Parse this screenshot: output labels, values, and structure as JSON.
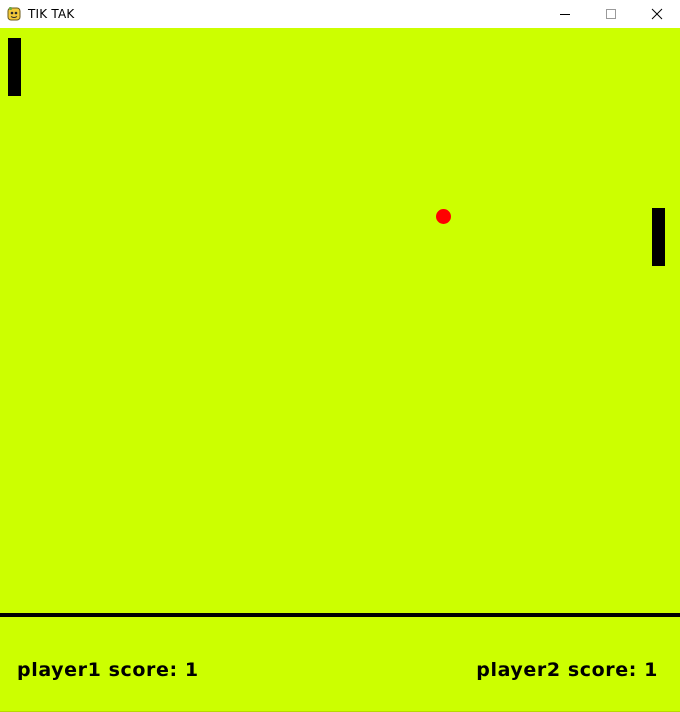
{
  "window": {
    "title": "TIK TAK",
    "icon": "pygame-snake-icon",
    "controls": {
      "minimize_icon": "minimize-icon",
      "maximize_icon": "maximize-icon",
      "close_icon": "close-icon"
    }
  },
  "game": {
    "background_color": "#ccff00",
    "paddle_color": "#000000",
    "ball_color": "#ff0000",
    "player1_score_text": "player1 score: 1",
    "player2_score_text": "player2 score: 1"
  }
}
